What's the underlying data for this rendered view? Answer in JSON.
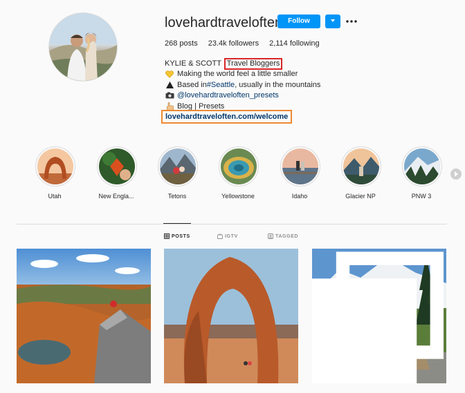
{
  "profile": {
    "username": "lovehardtraveloften",
    "follow_label": "Follow",
    "stats": {
      "posts": "268 posts",
      "followers": "23.4k followers",
      "following": "2,114 following"
    },
    "bio": {
      "name": "KYLIE & SCOTT",
      "category": "Travel Bloggers",
      "line1": "Making the world feel a little smaller",
      "line2_prefix": "Based in ",
      "line2_tag": "#Seattle",
      "line2_suffix": ", usually in the mountains",
      "line3": "@lovehardtraveloften_presets",
      "line4": "Blog | Presets",
      "url": "lovehardtraveloften.com/welcome"
    },
    "colors": {
      "follow": "#0095f6",
      "highlight_red": "#d9262a",
      "highlight_orange": "#ee8a32",
      "link": "#00376b"
    }
  },
  "highlights": [
    {
      "label": "Utah"
    },
    {
      "label": "New Engla..."
    },
    {
      "label": "Tetons"
    },
    {
      "label": "Yellowstone"
    },
    {
      "label": "Idaho"
    },
    {
      "label": "Glacier NP"
    },
    {
      "label": "PNW 3"
    }
  ],
  "tabs": [
    {
      "label": "POSTS",
      "icon": "grid-icon",
      "active": true
    },
    {
      "label": "IGTV",
      "icon": "igtv-icon",
      "active": false
    },
    {
      "label": "TAGGED",
      "icon": "tagged-icon",
      "active": false
    }
  ]
}
